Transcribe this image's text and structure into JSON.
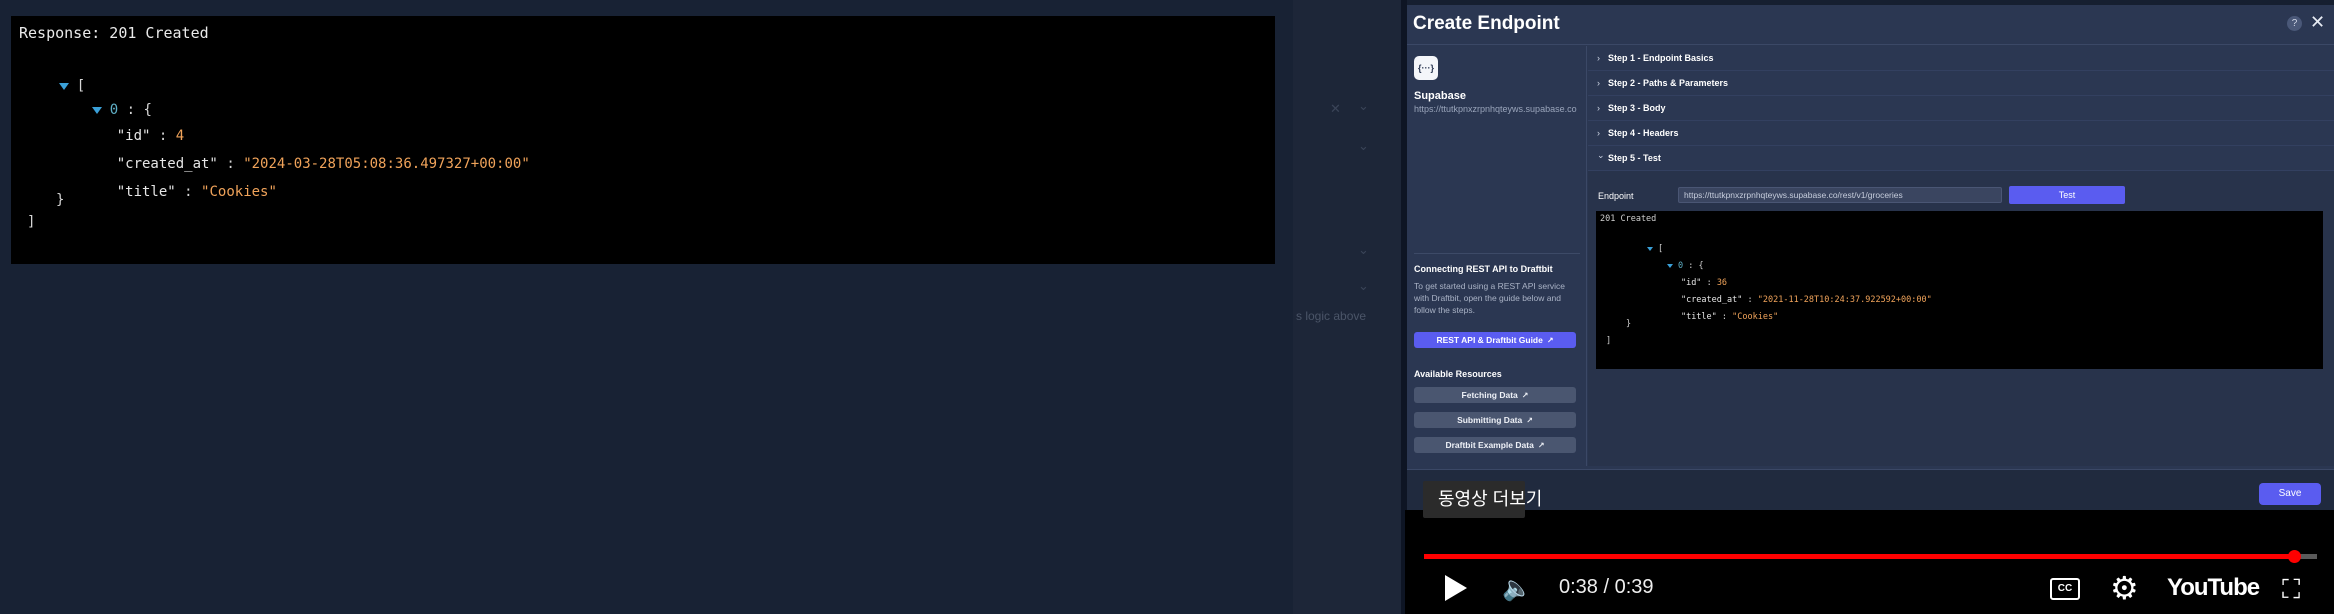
{
  "left_panel": {
    "response_title": "Response: 201 Created",
    "json": {
      "open_array": "[",
      "index": "0",
      "colon": ":",
      "open_obj": "{",
      "id_key": "\"id\"",
      "id_value": "4",
      "created_key": "\"created_at\"",
      "created_value": "\"2024-03-28T05:08:36.497327+00:00\"",
      "title_key": "\"title\"",
      "title_value": "\"Cookies\"",
      "close_obj": "}",
      "close_array": "]"
    }
  },
  "background": {
    "clear_icon": "✕",
    "chevron_icon": "⌄",
    "hint_text": "s logic above"
  },
  "modal": {
    "title": "Create Endpoint",
    "help_icon": "?",
    "close_icon": "✕",
    "sidebar": {
      "logo_text": "{···}",
      "api_name": "Supabase",
      "api_url": "https://ttutkpnxzrpnhqteyws.supabase.co",
      "connect_heading": "Connecting REST API to Draftbit",
      "connect_desc": "To get started using a REST API service with Draftbit, open the guide below and follow the steps.",
      "guide_button": "REST API & Draftbit Guide",
      "resources_heading": "Available Resources",
      "resources": [
        "Fetching Data",
        "Submitting Data",
        "Draftbit Example Data"
      ],
      "external_icon": "↗"
    },
    "steps": [
      {
        "label": "Step 1 - Endpoint Basics",
        "chevron": "›"
      },
      {
        "label": "Step 2 - Paths & Parameters",
        "chevron": "›"
      },
      {
        "label": "Step 3 - Body",
        "chevron": "›"
      },
      {
        "label": "Step 4 - Headers",
        "chevron": "›"
      },
      {
        "label": "Step 5 - Test",
        "chevron": "⌄"
      }
    ],
    "test": {
      "endpoint_label": "Endpoint",
      "endpoint_url": "https://ttutkpnxzrpnhqteyws.supabase.co/rest/v1/groceries",
      "test_button": "Test",
      "result_status": "201 Created",
      "json": {
        "open_array": "[",
        "index": "0",
        "colon": ":",
        "open_obj": "{",
        "id_key": "\"id\"",
        "id_value": "36",
        "created_key": "\"created_at\"",
        "created_value": "\"2021-11-28T10:24:37.922592+00:00\"",
        "title_key": "\"title\"",
        "title_value": "\"Cookies\"",
        "close_obj": "}",
        "close_array": "]"
      }
    },
    "save_button": "Save"
  },
  "youtube": {
    "more_videos": "동영상 더보기",
    "time": "0:38 / 0:39",
    "progress": 0.974,
    "volume_icon": "🔈",
    "cc_label": "CC",
    "gear_icon": "⚙",
    "logo_text": "YouTube",
    "fullscreen_icon": "⛶"
  }
}
